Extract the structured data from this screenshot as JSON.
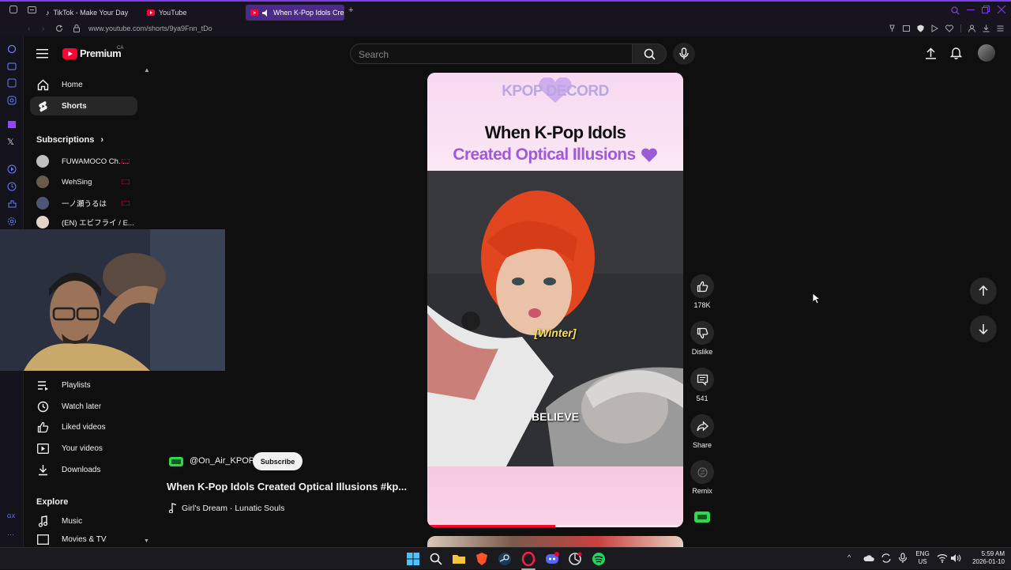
{
  "browser": {
    "tabs": [
      {
        "label": "TikTok - Make Your Day"
      },
      {
        "label": "YouTube"
      },
      {
        "label": "When K-Pop Idols Cre..."
      }
    ],
    "url": "www.youtube.com/shorts/9ya9Fnn_tDo"
  },
  "header": {
    "logo_text": "Premium",
    "region": "CA",
    "search_placeholder": "Search"
  },
  "sidebar": {
    "main": [
      {
        "label": "Home"
      },
      {
        "label": "Shorts"
      }
    ],
    "subscriptions_title": "Subscriptions",
    "subscriptions": [
      {
        "label": "FUWAMOCO Ch. ..."
      },
      {
        "label": "WehSing"
      },
      {
        "label": "一ノ瀬うるは"
      },
      {
        "label": "(EN) エビフライ / E..."
      }
    ],
    "you": [
      {
        "label": "Playlists"
      },
      {
        "label": "Watch later"
      },
      {
        "label": "Liked videos"
      },
      {
        "label": "Your videos"
      },
      {
        "label": "Downloads"
      }
    ],
    "explore_title": "Explore",
    "explore": [
      {
        "label": "Music"
      },
      {
        "label": "Movies & TV"
      }
    ]
  },
  "short": {
    "brand": "KPOP DECORD",
    "title_line1": "When K-Pop Idols",
    "title_line2": "Created Optical Illusions",
    "caption_tag": "[Winter]",
    "caption_word": "BELIEVE",
    "progress_fraction": 0.5,
    "channel": "@On_Air_KPOP",
    "subscribe_label": "Subscribe",
    "video_title": "When K-Pop Idols Created Optical Illusions #kp...",
    "sound": "Girl's Dream · Lunatic Souls"
  },
  "actions": {
    "likes": "178K",
    "dislike": "Dislike",
    "comments": "541",
    "share": "Share",
    "remix": "Remix"
  },
  "taskbar": {
    "lang": "ENG",
    "region": "US",
    "time": "5:59 AM",
    "date": "2026-01-10"
  },
  "colors": {
    "accent_purple": "#7b3fe4",
    "youtube_red": "#ff0033",
    "title_purple": "#a259d9"
  }
}
